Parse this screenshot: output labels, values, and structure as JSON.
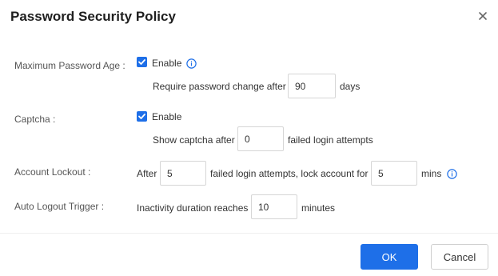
{
  "dialog": {
    "title": "Password Security Policy",
    "close_icon": "close-icon"
  },
  "max_password_age": {
    "label": "Maximum Password Age :",
    "enable_checked": true,
    "enable_label": "Enable",
    "info_icon": "info-icon",
    "prefix": "Require password change after",
    "value": "90",
    "suffix": "days"
  },
  "captcha": {
    "label": "Captcha :",
    "enable_checked": true,
    "enable_label": "Enable",
    "prefix": "Show captcha after",
    "value": "0",
    "suffix": "failed login attempts"
  },
  "account_lockout": {
    "label": "Account Lockout :",
    "prefix": "After",
    "attempts_value": "5",
    "middle": "failed login attempts, lock account for",
    "minutes_value": "5",
    "suffix": "mins",
    "info_icon": "info-icon"
  },
  "auto_logout": {
    "label": "Auto Logout Trigger :",
    "prefix": "Inactivity duration reaches",
    "value": "10",
    "suffix": "minutes"
  },
  "buttons": {
    "ok_label": "OK",
    "cancel_label": "Cancel"
  },
  "colors": {
    "primary": "#1e6fe8",
    "border": "#d6d6d6"
  }
}
